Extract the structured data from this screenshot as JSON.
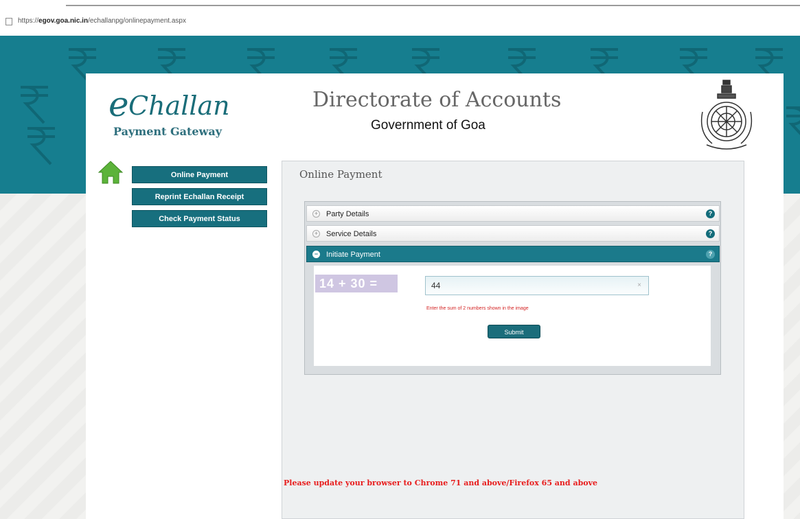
{
  "browser": {
    "url_prefix": "https://",
    "url_host": "egov.goa.nic.in",
    "url_path": "/echallanpg/onlinepayment.aspx"
  },
  "colors": {
    "primary": "#167e8f",
    "nav": "#176f7e",
    "notice": "#e81d1d"
  },
  "header": {
    "logo_e": "e",
    "logo_word": "Challan",
    "logo_sub": "Payment Gateway",
    "title": "Directorate of Accounts",
    "subtitle": "Government of Goa"
  },
  "sidebar": {
    "items": [
      {
        "label": "Online Payment"
      },
      {
        "label": "Reprint Echallan Receipt"
      },
      {
        "label": "Check Payment Status"
      }
    ]
  },
  "main": {
    "title": "Online Payment",
    "sections": [
      {
        "label": "Party Details"
      },
      {
        "label": "Service Details"
      },
      {
        "label": "Initiate Payment"
      }
    ],
    "captcha": {
      "text": "14 + 30 =",
      "answer": "44"
    },
    "hint": "Enter the sum of 2 numbers shown in the image",
    "submit_label": "Submit",
    "notice": "Please update your browser to Chrome 71 and above/Firefox 65 and above"
  }
}
